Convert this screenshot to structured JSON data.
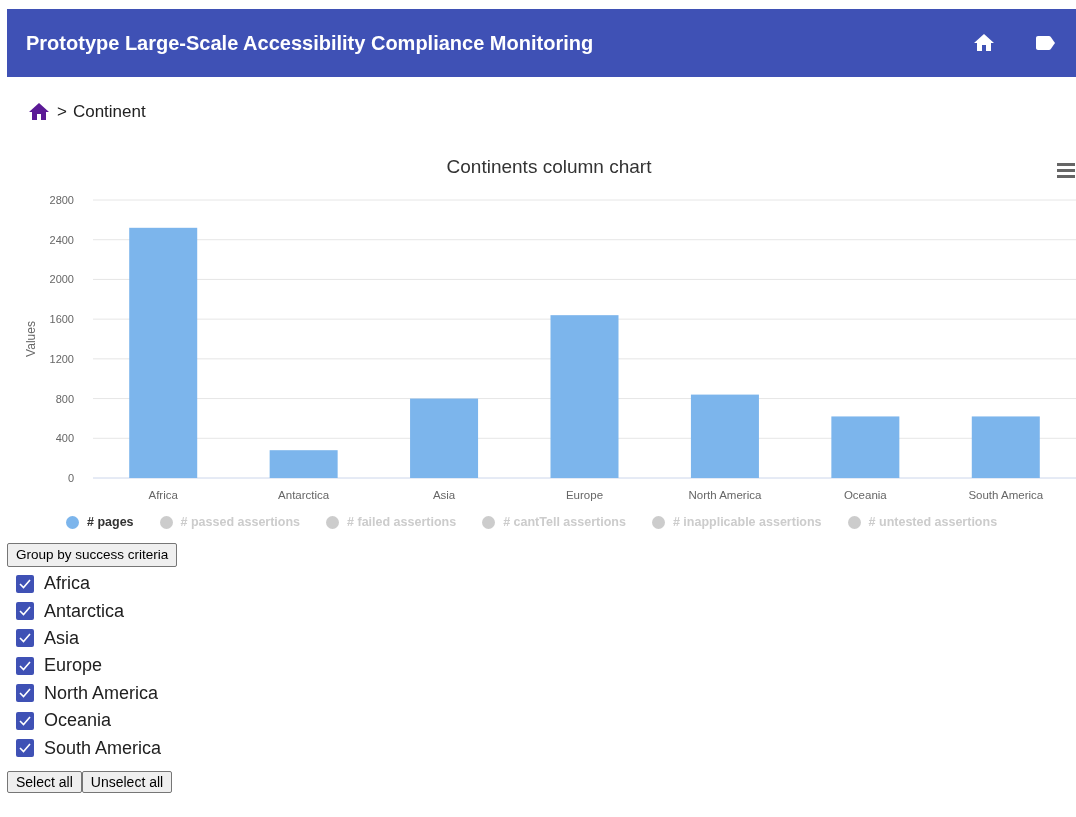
{
  "header": {
    "title": "Prototype Large-Scale Accessibility Compliance Monitoring"
  },
  "breadcrumb": {
    "separator": ">",
    "current": "Continent"
  },
  "chart": {
    "chart_data": {
      "type": "bar",
      "title": "Continents column chart",
      "ylabel": "Values",
      "categories": [
        "Africa",
        "Antarctica",
        "Asia",
        "Europe",
        "North America",
        "Oceania",
        "South America"
      ],
      "series": [
        {
          "name": "# pages",
          "color": "#7cb5ec",
          "values": [
            2520,
            280,
            800,
            1640,
            840,
            620,
            620
          ]
        }
      ],
      "grid": true,
      "ylim": [
        0,
        2800
      ],
      "yticks": [
        0,
        400,
        800,
        1200,
        1600,
        2000,
        2400,
        2800
      ]
    },
    "legend": [
      {
        "label": "# passed assertions",
        "visible": false
      },
      {
        "label": "# failed assertions",
        "visible": false
      },
      {
        "label": "# cantTell assertions",
        "visible": false
      },
      {
        "label": "# inapplicable assertions",
        "visible": false
      },
      {
        "label": "# untested assertions",
        "visible": false
      }
    ]
  },
  "group_button": "Group by success criteria",
  "continents": [
    {
      "label": "Africa",
      "checked": true
    },
    {
      "label": "Antarctica",
      "checked": true
    },
    {
      "label": "Asia",
      "checked": true
    },
    {
      "label": "Europe",
      "checked": true
    },
    {
      "label": "North America",
      "checked": true
    },
    {
      "label": "Oceania",
      "checked": true
    },
    {
      "label": "South America",
      "checked": true
    }
  ],
  "buttons": [
    "Select all",
    "Unselect all"
  ]
}
